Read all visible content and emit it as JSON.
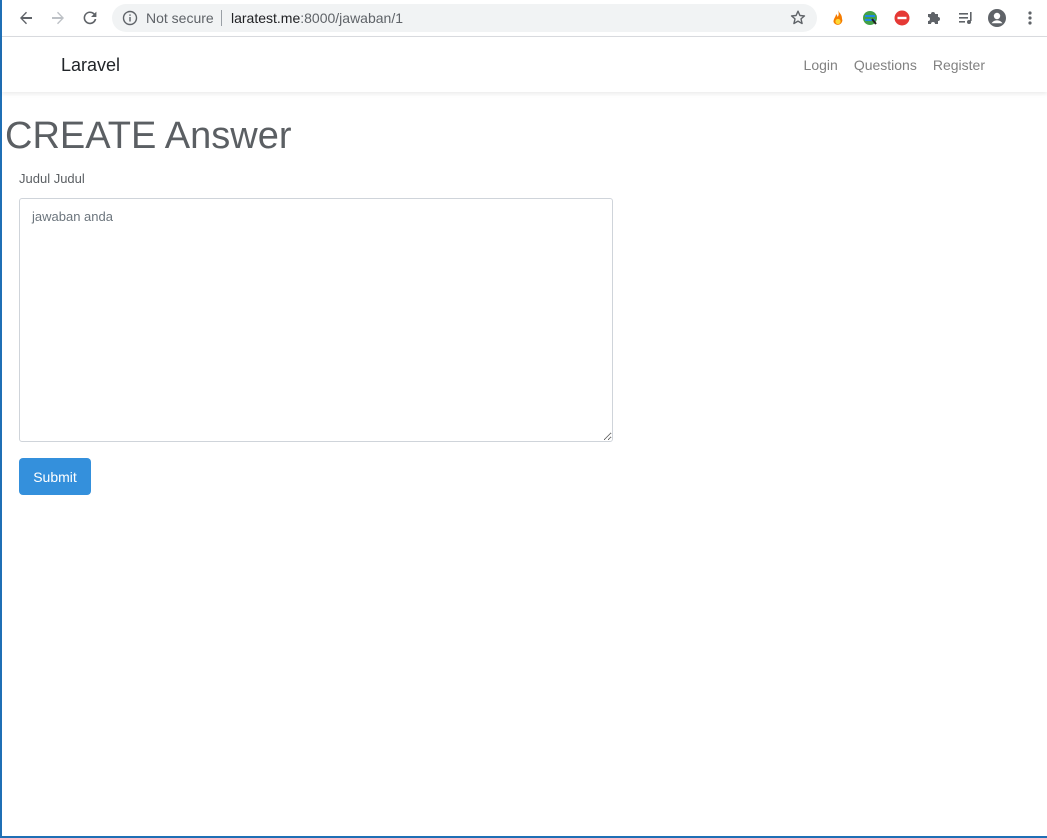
{
  "browser": {
    "security_label": "Not secure",
    "url_host": "laratest.me",
    "url_path": ":8000/jawaban/1"
  },
  "navbar": {
    "brand": "Laravel",
    "links": [
      "Login",
      "Questions",
      "Register"
    ]
  },
  "page": {
    "title": "CREATE Answer",
    "field_label": "Judul Judul",
    "answer_placeholder": "jawaban anda",
    "submit_label": "Submit"
  },
  "colors": {
    "primary_button": "#3490dc",
    "window_border": "#1f6fb5"
  }
}
